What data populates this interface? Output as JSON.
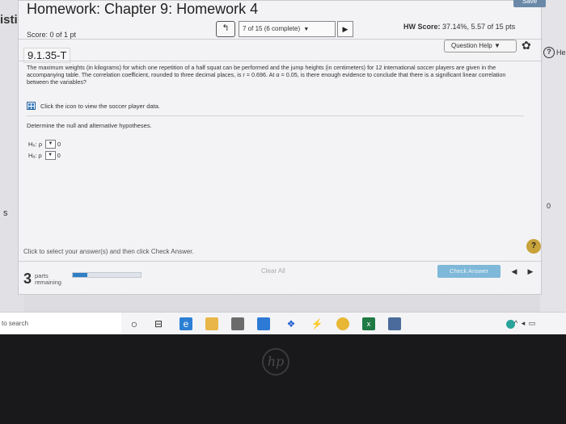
{
  "side": {
    "left_word": "isti",
    "left_mark": "s",
    "right_help": "?",
    "right_help_text": "He",
    "right_zero": "0"
  },
  "header": {
    "title": "Homework: Chapter 9: Homework 4",
    "save_label": "Save",
    "score": "Score: 0 of 1 pt",
    "prev_question": "↰",
    "question_progress": "7 of 15 (6 complete)",
    "next_question": "▶",
    "hw_score_label": "HW Score:",
    "hw_score_value": "37.14%, 5.57 of 15 pts"
  },
  "question": {
    "number": "9.1.35-T",
    "help_label": "Question Help",
    "prompt": "The maximum weights (in kilograms) for which one repetition of a half squat can be performed and the jump heights (in centimeters) for 12 international soccer players are given in the accompanying table. The correlation coefficient, rounded to three decimal places, is r = 0.696. At α = 0.05, is there enough evidence to conclude that there is a significant linear correlation between the variables?",
    "data_link": "Click the icon to view the soccer player data.",
    "instruction": "Determine the null and alternative hypotheses.",
    "h0": {
      "label": "H₀: ρ",
      "value": "0"
    },
    "ha": {
      "label": "Hₐ: ρ",
      "value": "0"
    }
  },
  "footer": {
    "instruction": "Click to select your answer(s) and then click Check Answer.",
    "help_badge": "?",
    "parts_count": "3",
    "parts_label": "parts",
    "parts_remaining": "remaining",
    "parts_progress_fraction": 0.22,
    "clear_all": "Clear All",
    "check_answer": "Check Answer",
    "prev": "◀",
    "next": "▶"
  },
  "taskbar": {
    "search_text": "to search",
    "icons": [
      "cortana-circle-icon",
      "task-view-icon",
      "edge-icon",
      "file-explorer-icon",
      "store-icon",
      "mail-icon",
      "dropbox-icon",
      "pen-icon",
      "chrome-icon",
      "excel-icon",
      "calculator-icon"
    ]
  },
  "bezel": {
    "logo": "hp"
  }
}
